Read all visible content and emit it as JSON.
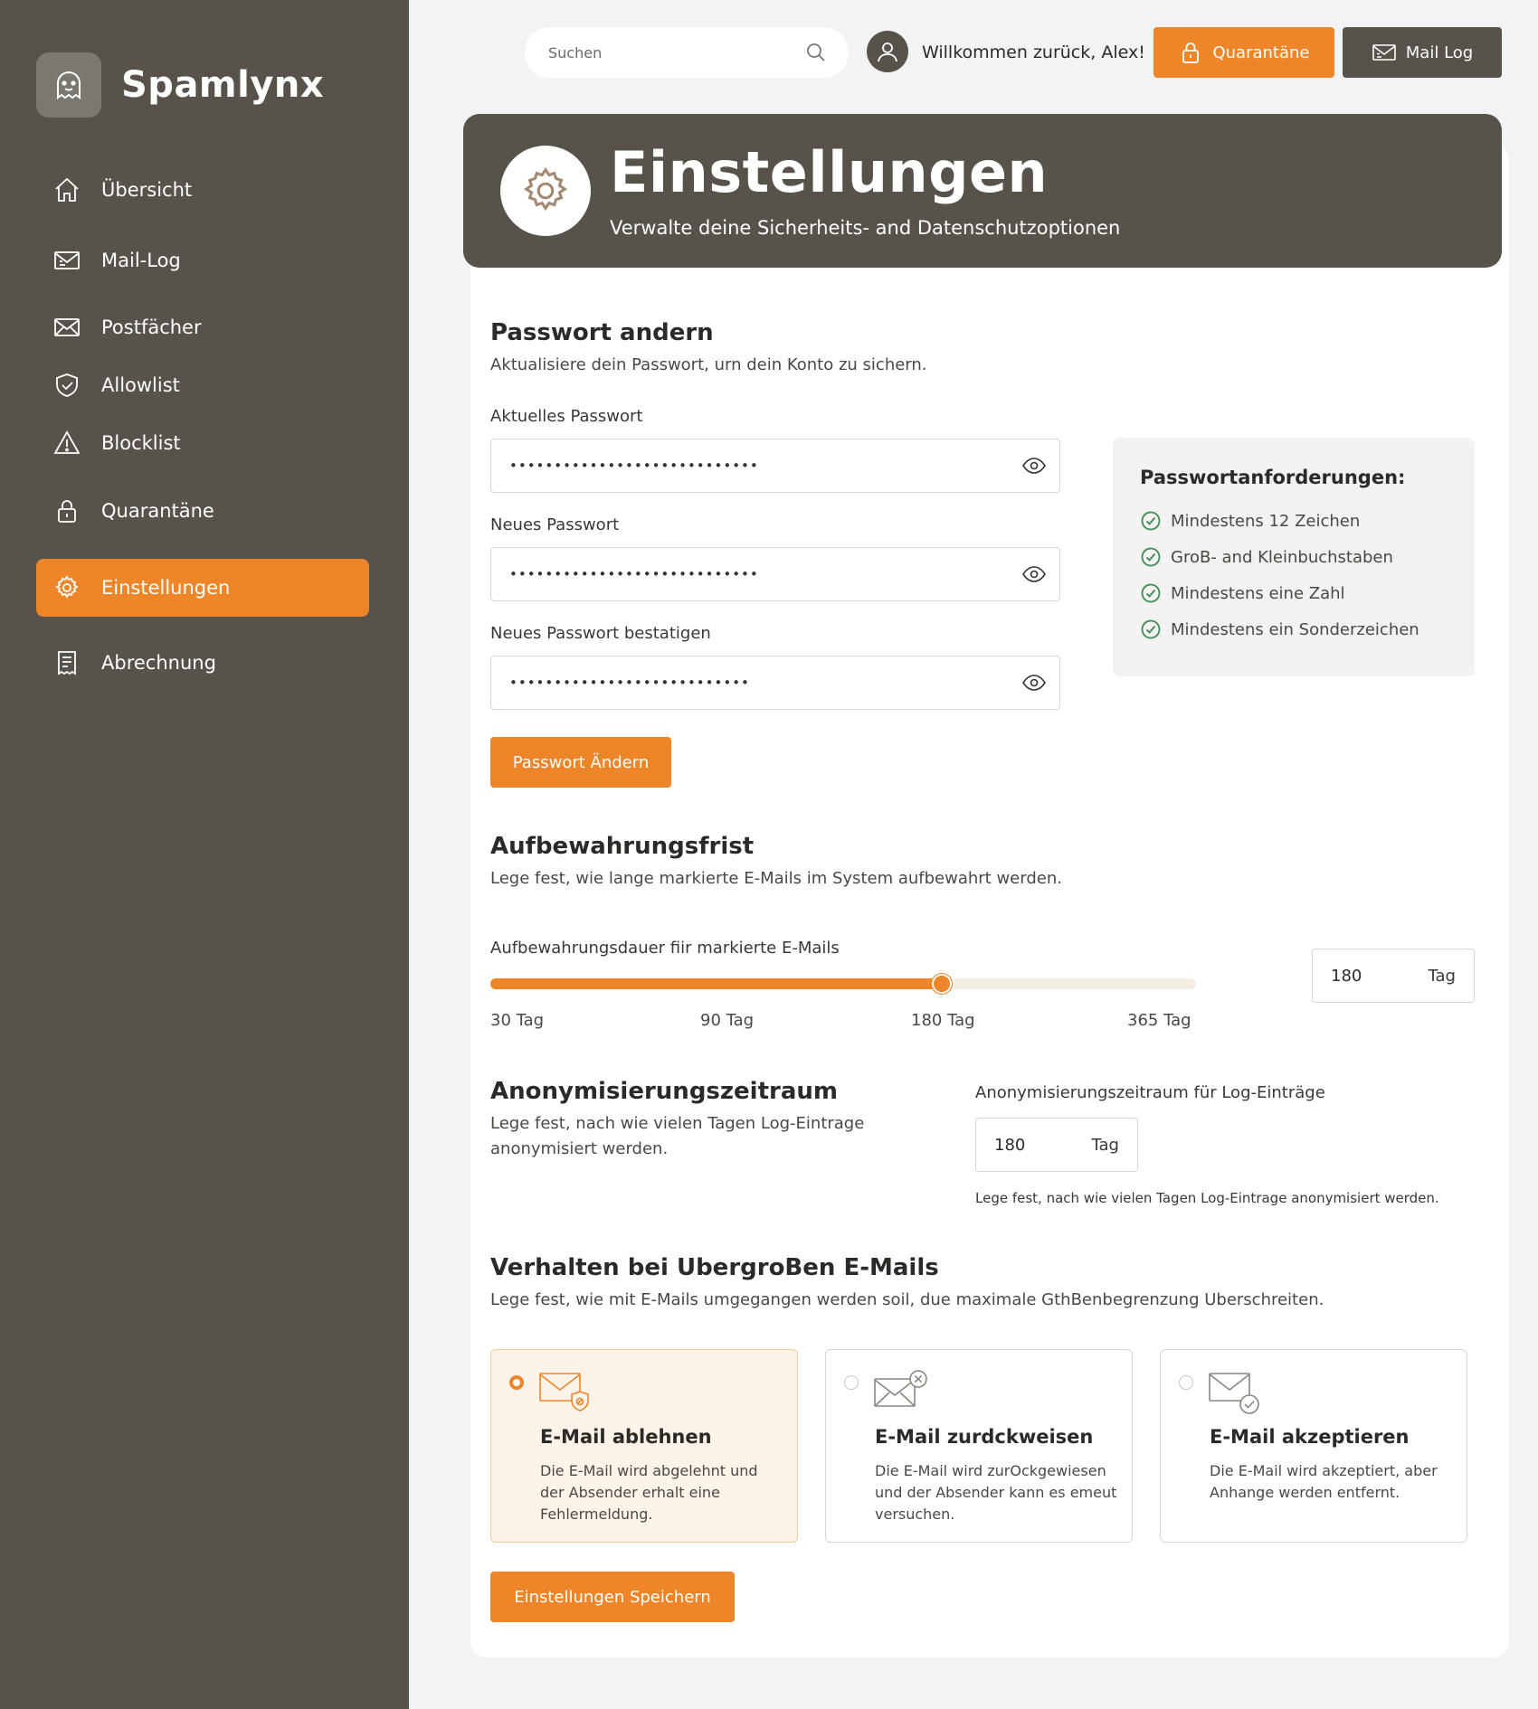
{
  "brand": {
    "name": "Spamlynx"
  },
  "sidebar": {
    "items": [
      {
        "label": "Übersicht",
        "icon": "home-icon"
      },
      {
        "label": "Mail-Log",
        "icon": "mail-log-icon"
      },
      {
        "label": "Postfächer",
        "icon": "envelope-icon"
      },
      {
        "label": "Allowlist",
        "icon": "shield-check-icon"
      },
      {
        "label": "Blocklist",
        "icon": "warning-icon"
      },
      {
        "label": "Quarantäne",
        "icon": "lock-icon"
      },
      {
        "label": "Einstellungen",
        "icon": "gear-icon",
        "active": true
      },
      {
        "label": "Abrechnung",
        "icon": "receipt-icon"
      }
    ]
  },
  "topbar": {
    "search_placeholder": "Suchen",
    "welcome": "Willkommen zurück, Alex!",
    "quarantine_label": "Quarantäne",
    "maillog_label": "Mail Log"
  },
  "header": {
    "title": "Einstellungen",
    "subtitle": "Verwalte deine Sicherheits- and Datenschutzoptionen"
  },
  "password": {
    "title": "Passwort andern",
    "description": "Aktualisiere dein Passwort, urn dein Konto zu sichern.",
    "current_label": "Aktuelles Passwort",
    "current_value": "••••••••••••••••••••••••••••",
    "new_label": "Neues Passwort",
    "new_value": "••••••••••••••••••••••••••••",
    "confirm_label": "Neues Passwort bestatigen",
    "confirm_value": "•••••••••••••••••••••••••••",
    "button": "Passwort Ändern",
    "requirements_title": "Passwortanforderungen:",
    "requirements": [
      "Mindestens 12 Zeichen",
      "GroB- and Kleinbuchstaben",
      "Mindestens eine Zahl",
      "Mindestens ein Sonderzeichen"
    ]
  },
  "retention": {
    "title": "Aufbewahrungsfrist",
    "description": "Lege fest, wie lange markierte E-Mails im System aufbewahrt werden.",
    "slider_label": "Aufbewahrungsdauer fiir markierte E-Mails",
    "ticks": [
      "30 Tag",
      "90 Tag",
      "180 Tag",
      "365 Tag"
    ],
    "slider_value": 180,
    "value": "180",
    "unit": "Tag"
  },
  "anonymization": {
    "title": "Anonymisierungszeitraum",
    "description": "Lege fest, nach wie vielen Tagen Log-Eintrage anonymisiert werden.",
    "field_label": "Anonymisierungszeitraum für Log-Einträge",
    "value": "180",
    "unit": "Tag",
    "note": "Lege fest, nach wie vielen Tagen Log-Eintrage anonymisiert werden."
  },
  "oversized": {
    "title": "Verhalten bei UbergroBen E-Mails",
    "description": "Lege fest, wie mit E-Mails umgegangen werden soil, due maximale GthBenbegrenzung Uberschreiten.",
    "options": [
      {
        "title": "E-Mail ablehnen",
        "description": "Die E-Mail wird abgelehnt und der Absender erhalt eine Fehlermeldung.",
        "icon": "mail-shield-icon",
        "selected": true
      },
      {
        "title": "E-Mail zurdckweisen",
        "description": "Die E-Mail wird zurOckgewiesen und der Absender kann es emeut versuchen.",
        "icon": "mail-x-icon",
        "selected": false
      },
      {
        "title": "E-Mail akzeptieren",
        "description": "Die E-Mail wird akzeptiert, aber Anhange werden entfernt.",
        "icon": "mail-check-icon",
        "selected": false
      }
    ]
  },
  "save_button": "Einstellungen Speichern",
  "colors": {
    "accent": "#ee8529",
    "sidebar": "#57534a",
    "success": "#3f8a4f"
  }
}
